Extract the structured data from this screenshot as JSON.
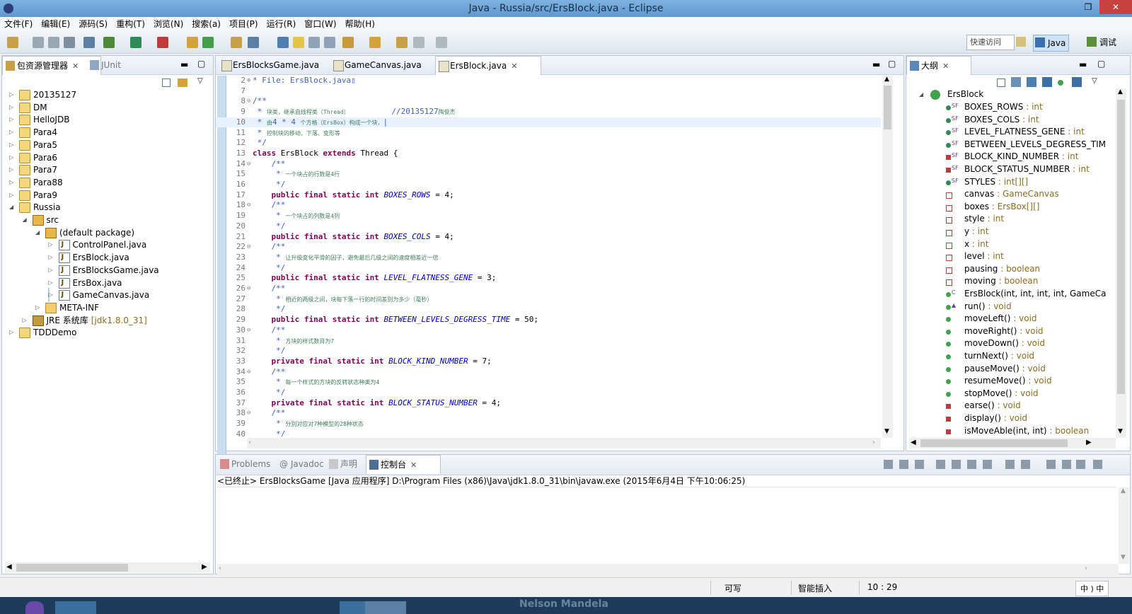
{
  "window": {
    "title": "Java - Russia/src/ErsBlock.java - Eclipse",
    "restore_glyph": "❐",
    "close_glyph": "✕"
  },
  "menu": [
    "文件(F)",
    "编辑(E)",
    "源码(S)",
    "重构(T)",
    "浏览(N)",
    "搜索(a)",
    "项目(P)",
    "运行(R)",
    "窗口(W)",
    "帮助(H)"
  ],
  "toolbar": {
    "quick_access": "快速访问",
    "perspectives": [
      {
        "label": "Java",
        "icon": "java-perspective-icon"
      },
      {
        "label": "调试",
        "icon": "debug-perspective-icon"
      }
    ]
  },
  "package_explorer": {
    "tabs": [
      {
        "label": "包资源管理器",
        "icon": "package-explorer-icon"
      },
      {
        "label": "JUnit",
        "icon": "junit-icon"
      }
    ],
    "tree": [
      {
        "label": "20135127",
        "depth": 0,
        "twisty": "▷",
        "icon": "proj"
      },
      {
        "label": "DM",
        "depth": 0,
        "twisty": "▷",
        "icon": "proj"
      },
      {
        "label": "HelloJDB",
        "depth": 0,
        "twisty": "▷",
        "icon": "proj"
      },
      {
        "label": "Para4",
        "depth": 0,
        "twisty": "▷",
        "icon": "proj"
      },
      {
        "label": "Para5",
        "depth": 0,
        "twisty": "▷",
        "icon": "proj"
      },
      {
        "label": "Para6",
        "depth": 0,
        "twisty": "▷",
        "icon": "proj"
      },
      {
        "label": "Para7",
        "depth": 0,
        "twisty": "▷",
        "icon": "proj"
      },
      {
        "label": "Para88",
        "depth": 0,
        "twisty": "▷",
        "icon": "proj"
      },
      {
        "label": "Para9",
        "depth": 0,
        "twisty": "▷",
        "icon": "proj"
      },
      {
        "label": "Russia",
        "depth": 0,
        "twisty": "◢",
        "icon": "proj"
      },
      {
        "label": "src",
        "depth": 1,
        "twisty": "◢",
        "icon": "pkg"
      },
      {
        "label": "(default package)",
        "depth": 2,
        "twisty": "◢",
        "icon": "pkg"
      },
      {
        "label": "ControlPanel.java",
        "depth": 3,
        "twisty": "▷",
        "icon": "java"
      },
      {
        "label": "ErsBlock.java",
        "depth": 3,
        "twisty": "▷",
        "icon": "java"
      },
      {
        "label": "ErsBlocksGame.java",
        "depth": 3,
        "twisty": "▷",
        "icon": "java"
      },
      {
        "label": "ErsBox.java",
        "depth": 3,
        "twisty": "▷",
        "icon": "java"
      },
      {
        "label": "GameCanvas.java",
        "depth": 3,
        "twisty": "▷",
        "icon": "java",
        "selected": true
      },
      {
        "label": "META-INF",
        "depth": 2,
        "twisty": "▷",
        "icon": "folder"
      },
      {
        "label": "JRE 系统库",
        "suffix": "[jdk1.8.0_31]",
        "depth": 1,
        "twisty": "▷",
        "icon": "lib"
      },
      {
        "label": "TDDDemo",
        "depth": 0,
        "twisty": "▷",
        "icon": "proj"
      }
    ]
  },
  "editor": {
    "tabs": [
      {
        "label": "ErsBlocksGame.java"
      },
      {
        "label": "GameCanvas.java"
      },
      {
        "label": "ErsBlock.java",
        "active": true
      }
    ],
    "lines": [
      {
        "n": "2",
        "fold": "⊕",
        "segs": [
          {
            "t": "* File: ErsBlock.java",
            "c": "cm"
          },
          {
            "t": "▯",
            "c": "cm"
          }
        ]
      },
      {
        "n": "7",
        "segs": []
      },
      {
        "n": "8",
        "fold": "⊖",
        "segs": [
          {
            "t": "/**",
            "c": "cm"
          }
        ]
      },
      {
        "n": "9",
        "segs": [
          {
            "t": " * ",
            "c": "cm"
          },
          {
            "t": "块类，继承自线程类（Thread）",
            "c": "cj"
          },
          {
            "t": "         //20135127",
            "c": "cm"
          },
          {
            "t": "陶俊杰",
            "c": "cj"
          }
        ]
      },
      {
        "n": "10",
        "hl": true,
        "segs": [
          {
            "t": " * ",
            "c": "cm"
          },
          {
            "t": "由",
            "c": "cj"
          },
          {
            "t": "4 * 4 ",
            "c": "cm"
          },
          {
            "t": "个方格（ErsBox）构成一个块，",
            "c": "cj"
          },
          {
            "t": "|",
            "c": "cm"
          }
        ]
      },
      {
        "n": "11",
        "segs": [
          {
            "t": " * ",
            "c": "cm"
          },
          {
            "t": "控制块的移动、下落、变形等",
            "c": "cj"
          }
        ]
      },
      {
        "n": "12",
        "segs": [
          {
            "t": " */",
            "c": "cm"
          }
        ]
      },
      {
        "n": "13",
        "segs": [
          {
            "t": "class",
            "c": "kw"
          },
          {
            "t": " ErsBlock ",
            "c": ""
          },
          {
            "t": "extends",
            "c": "kw"
          },
          {
            "t": " Thread {",
            "c": ""
          }
        ]
      },
      {
        "n": "14",
        "fold": "⊖",
        "segs": [
          {
            "t": "    /**",
            "c": "cm"
          }
        ]
      },
      {
        "n": "15",
        "segs": [
          {
            "t": "     * ",
            "c": "cm"
          },
          {
            "t": "一个块占的行数是4行",
            "c": "cj"
          }
        ]
      },
      {
        "n": "16",
        "segs": [
          {
            "t": "     */",
            "c": "cm"
          }
        ]
      },
      {
        "n": "17",
        "segs": [
          {
            "t": "    public final static int",
            "c": "kw"
          },
          {
            "t": " ",
            "c": ""
          },
          {
            "t": "BOXES_ROWS",
            "c": "fd"
          },
          {
            "t": " = 4;",
            "c": ""
          }
        ]
      },
      {
        "n": "18",
        "fold": "⊖",
        "segs": [
          {
            "t": "    /**",
            "c": "cm"
          }
        ]
      },
      {
        "n": "19",
        "segs": [
          {
            "t": "     * ",
            "c": "cm"
          },
          {
            "t": "一个块占的列数是4列",
            "c": "cj"
          }
        ]
      },
      {
        "n": "20",
        "segs": [
          {
            "t": "     */",
            "c": "cm"
          }
        ]
      },
      {
        "n": "21",
        "segs": [
          {
            "t": "    public final static int",
            "c": "kw"
          },
          {
            "t": " ",
            "c": ""
          },
          {
            "t": "BOXES_COLS",
            "c": "fd"
          },
          {
            "t": " = 4;",
            "c": ""
          }
        ]
      },
      {
        "n": "22",
        "fold": "⊖",
        "segs": [
          {
            "t": "    /**",
            "c": "cm"
          }
        ]
      },
      {
        "n": "23",
        "segs": [
          {
            "t": "     * ",
            "c": "cm"
          },
          {
            "t": "让升级变化平滑的因子，避免最后几级之间的速度相差近一倍",
            "c": "cj"
          }
        ]
      },
      {
        "n": "24",
        "segs": [
          {
            "t": "     */",
            "c": "cm"
          }
        ]
      },
      {
        "n": "25",
        "segs": [
          {
            "t": "    public final static int",
            "c": "kw"
          },
          {
            "t": " ",
            "c": ""
          },
          {
            "t": "LEVEL_FLATNESS_GENE",
            "c": "fd"
          },
          {
            "t": " = 3;",
            "c": ""
          }
        ]
      },
      {
        "n": "26",
        "fold": "⊖",
        "segs": [
          {
            "t": "    /**",
            "c": "cm"
          }
        ]
      },
      {
        "n": "27",
        "segs": [
          {
            "t": "     * ",
            "c": "cm"
          },
          {
            "t": "相近的两级之间，块每下落一行的时间差别为多少（毫秒）",
            "c": "cj"
          }
        ]
      },
      {
        "n": "28",
        "segs": [
          {
            "t": "     */",
            "c": "cm"
          }
        ]
      },
      {
        "n": "29",
        "segs": [
          {
            "t": "    public final static int",
            "c": "kw"
          },
          {
            "t": " ",
            "c": ""
          },
          {
            "t": "BETWEEN_LEVELS_DEGRESS_TIME",
            "c": "fd"
          },
          {
            "t": " = 50;",
            "c": ""
          }
        ]
      },
      {
        "n": "30",
        "fold": "⊖",
        "segs": [
          {
            "t": "    /**",
            "c": "cm"
          }
        ]
      },
      {
        "n": "31",
        "segs": [
          {
            "t": "     * ",
            "c": "cm"
          },
          {
            "t": "方块的样式数目为7",
            "c": "cj"
          }
        ]
      },
      {
        "n": "32",
        "segs": [
          {
            "t": "     */",
            "c": "cm"
          }
        ]
      },
      {
        "n": "33",
        "segs": [
          {
            "t": "    private final static int",
            "c": "kw"
          },
          {
            "t": " ",
            "c": ""
          },
          {
            "t": "BLOCK_KIND_NUMBER",
            "c": "fd"
          },
          {
            "t": " = 7;",
            "c": ""
          }
        ]
      },
      {
        "n": "34",
        "fold": "⊖",
        "segs": [
          {
            "t": "    /**",
            "c": "cm"
          }
        ]
      },
      {
        "n": "35",
        "segs": [
          {
            "t": "     * ",
            "c": "cm"
          },
          {
            "t": "每一个样式的方块的反转状态种类为4",
            "c": "cj"
          }
        ]
      },
      {
        "n": "36",
        "segs": [
          {
            "t": "     */",
            "c": "cm"
          }
        ]
      },
      {
        "n": "37",
        "segs": [
          {
            "t": "    private final static int",
            "c": "kw"
          },
          {
            "t": " ",
            "c": ""
          },
          {
            "t": "BLOCK_STATUS_NUMBER",
            "c": "fd"
          },
          {
            "t": " = 4;",
            "c": ""
          }
        ]
      },
      {
        "n": "38",
        "fold": "⊖",
        "segs": [
          {
            "t": "    /**",
            "c": "cm"
          }
        ]
      },
      {
        "n": "39",
        "segs": [
          {
            "t": "     * ",
            "c": "cm"
          },
          {
            "t": "分别对应对7种模型的28种状态",
            "c": "cj"
          }
        ]
      },
      {
        "n": "40",
        "segs": [
          {
            "t": "     */",
            "c": "cm"
          }
        ]
      }
    ]
  },
  "outline": {
    "tab": {
      "label": "大纲",
      "icon": "outline-icon"
    },
    "root": "ErsBlock",
    "members": [
      {
        "name": "BOXES_ROWS",
        "type": " : int",
        "kind": "sf",
        "sup": "SF"
      },
      {
        "name": "BOXES_COLS",
        "type": " : int",
        "kind": "sf",
        "sup": "SF"
      },
      {
        "name": "LEVEL_FLATNESS_GENE",
        "type": " : int",
        "kind": "sf",
        "sup": "SF"
      },
      {
        "name": "BETWEEN_LEVELS_DEGRESS_TIM",
        "type": "",
        "kind": "sf",
        "sup": "SF"
      },
      {
        "name": "BLOCK_KIND_NUMBER",
        "type": " : int",
        "kind": "privm",
        "sup": "SF"
      },
      {
        "name": "BLOCK_STATUS_NUMBER",
        "type": " : int",
        "kind": "privm",
        "sup": "SF"
      },
      {
        "name": "STYLES",
        "type": " : int[][]",
        "kind": "sf",
        "sup": "SF"
      },
      {
        "name": "canvas",
        "type": " : GameCanvas",
        "kind": "priv"
      },
      {
        "name": "boxes",
        "type": " : ErsBox[][]",
        "kind": "priv"
      },
      {
        "name": "style",
        "type": " : int",
        "kind": "priv"
      },
      {
        "name": "y",
        "type": " : int",
        "kind": "priv"
      },
      {
        "name": "x",
        "type": " : int",
        "kind": "priv"
      },
      {
        "name": "level",
        "type": " : int",
        "kind": "priv"
      },
      {
        "name": "pausing",
        "type": " : boolean",
        "kind": "priv"
      },
      {
        "name": "moving",
        "type": " : boolean",
        "kind": "priv"
      },
      {
        "name": "ErsBlock(int, int, int, int, GameCa",
        "type": "",
        "kind": "pub",
        "sup": "C"
      },
      {
        "name": "run()",
        "type": " : void",
        "kind": "pub",
        "sup": "▲"
      },
      {
        "name": "moveLeft()",
        "type": " : void",
        "kind": "pub"
      },
      {
        "name": "moveRight()",
        "type": " : void",
        "kind": "pub"
      },
      {
        "name": "moveDown()",
        "type": " : void",
        "kind": "pub"
      },
      {
        "name": "turnNext()",
        "type": " : void",
        "kind": "pub"
      },
      {
        "name": "pauseMove()",
        "type": " : void",
        "kind": "pub"
      },
      {
        "name": "resumeMove()",
        "type": " : void",
        "kind": "pub"
      },
      {
        "name": "stopMove()",
        "type": " : void",
        "kind": "pub"
      },
      {
        "name": "earse()",
        "type": " : void",
        "kind": "privm"
      },
      {
        "name": "display()",
        "type": " : void",
        "kind": "privm"
      },
      {
        "name": "isMoveAble(int, int)",
        "type": " : boolean",
        "kind": "privm"
      }
    ]
  },
  "bottom": {
    "tabs": [
      {
        "label": "Problems"
      },
      {
        "label": "@ Javadoc"
      },
      {
        "label": "声明"
      },
      {
        "label": "控制台",
        "active": true
      }
    ],
    "console_header": "<已终止> ErsBlocksGame [Java 应用程序] D:\\Program Files (x86)\\Java\\jdk1.8.0_31\\bin\\javaw.exe (2015年6月4日 下午10:06:25)"
  },
  "status": {
    "writable": "可写",
    "insert_mode": "智能插入",
    "position": "10 : 29",
    "ime": "中 ) 中"
  },
  "taskbar": {
    "text": "Nelson Mandela"
  },
  "colors": {
    "keyword": "#7f0055",
    "comment": "#3f5fbf",
    "field": "#0000c0",
    "titlebar": "#6fa8dc"
  }
}
